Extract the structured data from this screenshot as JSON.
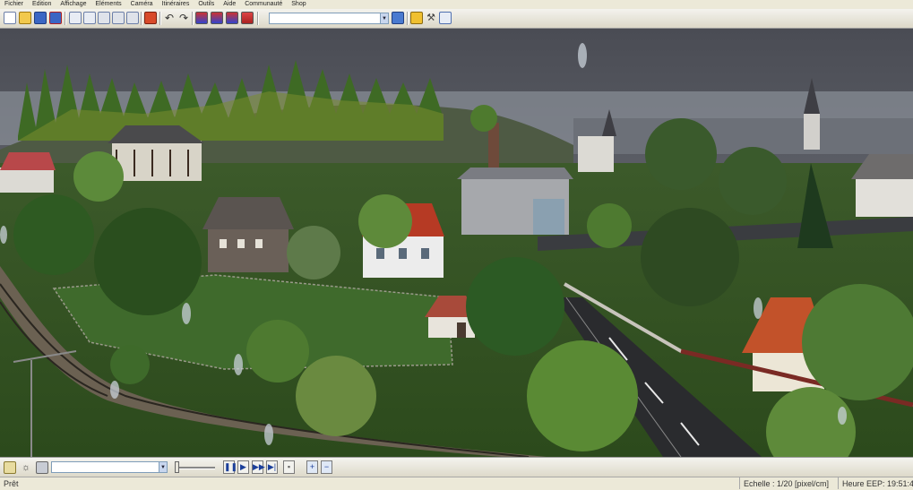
{
  "menu": [
    "Fichier",
    "Edition",
    "Affichage",
    "Eléments",
    "Caméra",
    "Itinéraires",
    "Outils",
    "Aide",
    "Communauté",
    "Shop"
  ],
  "toolbar": {
    "search_value": ""
  },
  "bottom_toolbar": {
    "combo_value": ""
  },
  "status": {
    "ready": "Prêt",
    "scale": "Echelle : 1/20 [pixel/cm]",
    "time": "Heure EEP: 19:51:4"
  },
  "icons": [
    "new-file-icon",
    "open-folder-icon",
    "save-icon",
    "save-as-icon",
    "copy-icon",
    "paste-icon",
    "layer-icon",
    "undo-icon",
    "redo-icon",
    "track-edit-icon",
    "train-icon",
    "signal-icon",
    "camera-icon",
    "settings-icon",
    "tools-icon",
    "info-icon",
    "edit-icon",
    "light-icon",
    "camera-view-icon",
    "pause-icon",
    "play-icon",
    "fast-forward-icon",
    "fastest-icon",
    "record-icon",
    "zoom-in-icon",
    "zoom-out-icon"
  ]
}
